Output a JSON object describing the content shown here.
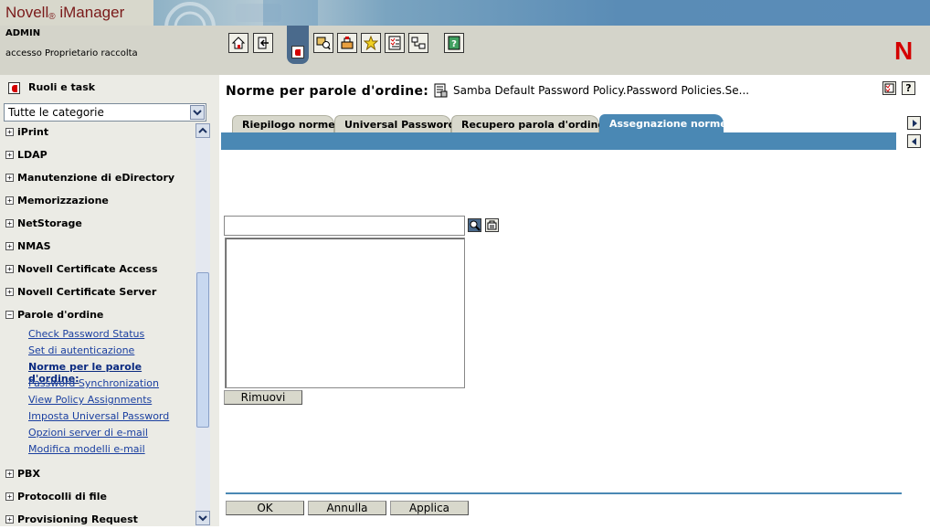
{
  "header": {
    "brand": "Novell",
    "brand_suffix": "®",
    "product": "iManager",
    "user_name": "ADMIN",
    "user_role": "accesso Proprietario raccolta",
    "logo": "N"
  },
  "toolbar": {
    "buttons": [
      "home-icon",
      "exit-icon",
      "roles-tasks-icon",
      "view-objects-icon",
      "configure-icon",
      "favorites-icon",
      "task-list-icon",
      "hierarchy-icon",
      "help-book-icon"
    ]
  },
  "sidebar": {
    "title": "Ruoli e task",
    "category_select": "Tutte le categorie",
    "categories": [
      {
        "label": "iPrint",
        "expanded": false
      },
      {
        "label": "LDAP",
        "expanded": false
      },
      {
        "label": "Manutenzione di eDirectory",
        "expanded": false
      },
      {
        "label": "Memorizzazione",
        "expanded": false
      },
      {
        "label": "NetStorage",
        "expanded": false
      },
      {
        "label": "NMAS",
        "expanded": false
      },
      {
        "label": "Novell Certificate Access",
        "expanded": false
      },
      {
        "label": "Novell Certificate Server",
        "expanded": false
      },
      {
        "label": "Parole d'ordine",
        "expanded": true
      },
      {
        "label": "PBX",
        "expanded": false
      },
      {
        "label": "Protocolli di file",
        "expanded": false
      },
      {
        "label": "Provisioning Request",
        "expanded": false
      }
    ],
    "password_tasks": [
      {
        "label": "Check Password Status",
        "active": false
      },
      {
        "label": "Set di autenticazione",
        "active": false
      },
      {
        "label": "Norme per le parole d'ordine:",
        "active": true
      },
      {
        "label": "Password Synchronization",
        "active": false
      },
      {
        "label": "View Policy Assignments",
        "active": false
      },
      {
        "label": "Imposta Universal Password",
        "active": false
      },
      {
        "label": "Opzioni server di e-mail",
        "active": false
      },
      {
        "label": "Modifica modelli e-mail",
        "active": false
      }
    ]
  },
  "main": {
    "title": "Norme per parole d'ordine:",
    "policy_name": "Samba Default Password Policy.Password Policies.Se...",
    "tabs": [
      {
        "label": "Riepilogo norme",
        "active": false
      },
      {
        "label": "Universal Password",
        "active": false
      },
      {
        "label": "Recupero parola d'ordine",
        "active": false
      },
      {
        "label": "Assegnazione norme",
        "active": true
      }
    ],
    "search_value": "",
    "remove_label": "Rimuovi",
    "ok_label": "OK",
    "cancel_label": "Annulla",
    "apply_label": "Applica"
  },
  "colors": {
    "accent_blue": "#4a88b4",
    "sidebar_bg": "#ebebe5",
    "header_bg": "#d4d4ca",
    "logo_red": "#d40000",
    "link_blue": "#1a3fa0"
  }
}
